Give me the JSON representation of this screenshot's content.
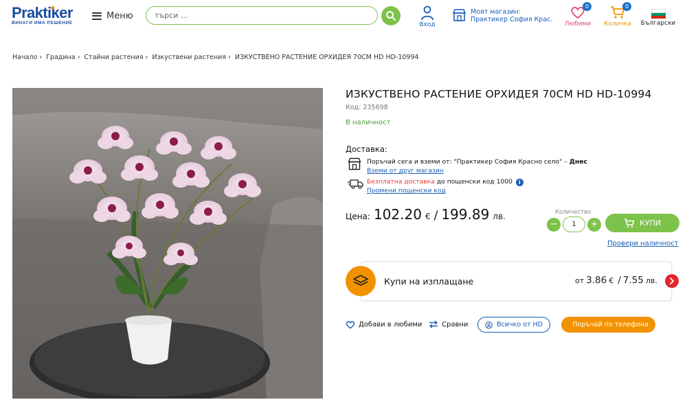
{
  "header": {
    "logo_name": "Praktiker",
    "logo_tagline": "ВИНАГИ ИМА РЕШЕНИЕ",
    "menu_label": "Меню",
    "search_placeholder": "търси ...",
    "login_label": "Вход",
    "store_line1": "Моят магазин:",
    "store_line2": "Практикер София Крас...",
    "favorites_label": "Любими",
    "favorites_count": "0",
    "cart_label": "Количка",
    "cart_count": "0",
    "language_label": "Български",
    "colors": {
      "brand_blue": "#1a4da0",
      "green": "#7dc24b",
      "orange": "#f39200",
      "pink": "#e0457b"
    }
  },
  "breadcrumb": [
    "Начало",
    "Градина",
    "Стайни растения",
    "Изкуствени растения",
    "ИЗКУСТВЕНО РАСТЕНИЕ ОРХИДЕЯ 70СМ HD HD-10994"
  ],
  "product": {
    "title": "ИЗКУСТВЕНО РАСТЕНИЕ ОРХИДЕЯ 70СМ HD HD-10994",
    "code": "Код: 235698",
    "stock": "В наличност",
    "delivery_heading": "Доставка:",
    "pickup_prefix": "Поръчай сега и вземи от: \"Практикер София Красно село\" – ",
    "pickup_when": "Днес",
    "pickup_link": "Вземи от друг магазин",
    "free_delivery": "Безплатна доставка",
    "free_delivery_suffix": " до пощенски код 1000",
    "postcode_link": "Промени пощенски код",
    "price_label": "Цена:",
    "price_eur": "102.20",
    "eur_symbol": "€",
    "price_sep": "/",
    "price_bgn": "199.89",
    "bgn_symbol": "лв.",
    "qty_label": "Количество",
    "qty_value": "1",
    "buy_label": "КУПИ",
    "check_label": "Провери наличност"
  },
  "installments": {
    "label": "Купи на изплащане",
    "prefix": "от",
    "eur": "3.86",
    "eur_symbol": "€",
    "sep": "/",
    "bgn": "7.55",
    "bgn_symbol": "лв."
  },
  "actions": {
    "favorite": "Добави в любими",
    "compare": "Сравни",
    "all_from": "Всичко от HD",
    "phone_order": "Поръчай по телефона"
  }
}
